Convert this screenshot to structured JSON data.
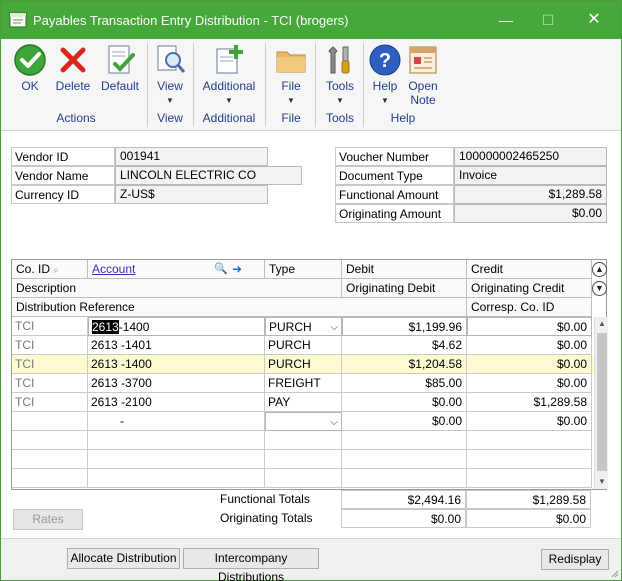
{
  "window": {
    "title": "Payables Transaction Entry Distribution  -  TCI (brogers)",
    "minimize": "—",
    "maximize": "☐",
    "close": "✕",
    "title_color": "#46a83a"
  },
  "ribbon": {
    "buttons": [
      {
        "label": "OK",
        "icon": "ok-check-icon"
      },
      {
        "label": "Delete",
        "icon": "delete-x-icon"
      },
      {
        "label": "Default",
        "icon": "default-doc-check-icon"
      },
      {
        "label": "View",
        "icon": "view-magnifier-icon"
      },
      {
        "label": "Additional",
        "icon": "additional-plus-icon"
      },
      {
        "label": "File",
        "icon": "folder-icon"
      },
      {
        "label": "Tools",
        "icon": "tools-icon"
      },
      {
        "label": "Help",
        "icon": "help-icon"
      },
      {
        "label": "Open Note",
        "line1": "Open",
        "line2": "Note",
        "icon": "note-icon"
      }
    ],
    "groups": [
      "Actions",
      "View",
      "Additional",
      "File",
      "Tools",
      "Help"
    ]
  },
  "header": {
    "vendor_id_label": "Vendor ID",
    "vendor_id": "001941",
    "vendor_name_label": "Vendor Name",
    "vendor_name": "LINCOLN ELECTRIC CO",
    "currency_id_label": "Currency ID",
    "currency_id": "Z-US$",
    "voucher_number_label": "Voucher Number",
    "voucher_number": "100000002465250",
    "document_type_label": "Document Type",
    "document_type": "Invoice",
    "functional_amount_label": "Functional Amount",
    "functional_amount": "$1,289.58",
    "originating_amount_label": "Originating Amount",
    "originating_amount": "$0.00"
  },
  "grid": {
    "headers": {
      "co_id": "Co. ID",
      "account": "Account",
      "type": "Type",
      "debit": "Debit",
      "credit": "Credit",
      "description": "Description",
      "originating_debit": "Originating Debit",
      "originating_credit": "Originating Credit",
      "distribution_reference": "Distribution Reference",
      "corresp_co_id": "Corresp. Co. ID"
    },
    "rows": [
      {
        "co": "TCI",
        "acct_a": "2613",
        "acct_b": "-1400",
        "type": "PURCH",
        "debit": "$1,199.96",
        "credit": "$0.00"
      },
      {
        "co": "TCI",
        "acct_a": "2613",
        "acct_b": "-1401",
        "type": "PURCH",
        "debit": "$4.62",
        "credit": "$0.00"
      },
      {
        "co": "TCI",
        "acct_a": "2613",
        "acct_b": "-1400",
        "type": "PURCH",
        "debit": "$1,204.58",
        "credit": "$0.00"
      },
      {
        "co": "TCI",
        "acct_a": "2613",
        "acct_b": "-3700",
        "type": "FREIGHT",
        "debit": "$85.00",
        "credit": "$0.00"
      },
      {
        "co": "TCI",
        "acct_a": "2613",
        "acct_b": "-2100",
        "type": "PAY",
        "debit": "$0.00",
        "credit": "$1,289.58"
      },
      {
        "co": "",
        "acct_a": "",
        "acct_b": "-",
        "type": "",
        "debit": "$0.00",
        "credit": "$0.00"
      }
    ],
    "highlight_color": "#fdfbd2"
  },
  "totals": {
    "functional_label": "Functional Totals",
    "functional_debit": "$2,494.16",
    "functional_credit": "$1,289.58",
    "originating_label": "Originating Totals",
    "originating_debit": "$0.00",
    "originating_credit": "$0.00"
  },
  "buttons": {
    "rates": "Rates",
    "allocate": "Allocate Distribution",
    "intercompany": "Intercompany Distributions",
    "redisplay": "Redisplay"
  }
}
